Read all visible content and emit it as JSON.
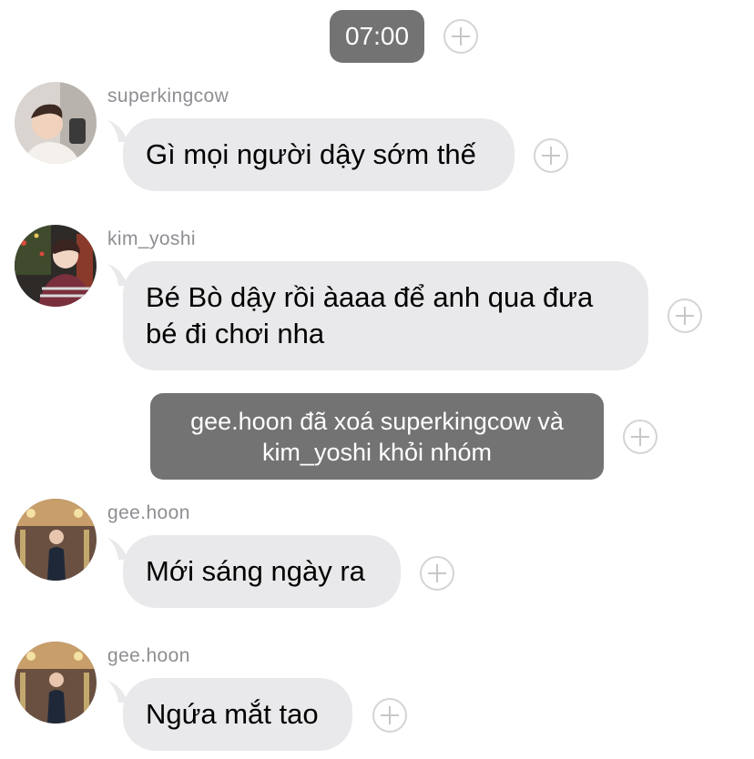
{
  "timestamp": "07:00",
  "messages": [
    {
      "sender": "superkingcow",
      "text": "Gì mọi người dậy sớm thế"
    },
    {
      "sender": "kim_yoshi",
      "text": "Bé Bò dậy rồi àaaa để anh qua đưa bé đi chơi nha"
    },
    {
      "sender": "gee.hoon",
      "text": "Mới sáng ngày ra"
    },
    {
      "sender": "gee.hoon",
      "text": "Ngứa mắt tao"
    }
  ],
  "system_notice": "gee.hoon đã xoá superkingcow và kim_yoshi khỏi nhóm",
  "colors": {
    "bubble": "#e9e9eb",
    "pill": "#737373",
    "sender_text": "#8e8e93",
    "plus_icon": "#c7c7c7"
  }
}
